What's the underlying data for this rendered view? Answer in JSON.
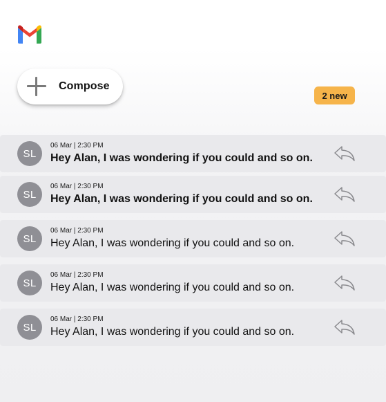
{
  "app": {
    "logo_icon": "gmail-logo-icon"
  },
  "compose": {
    "label": "Compose",
    "icon": "plus-icon"
  },
  "badge": {
    "label": "2 new",
    "color": "#f6b44a"
  },
  "emails": [
    {
      "avatar": "SL",
      "date": "06 Mar | 2:30 PM",
      "subject": "Hey Alan, I was wondering if you could and so on.",
      "unread": true,
      "action_icon": "reply-icon"
    },
    {
      "avatar": "SL",
      "date": "06 Mar | 2:30 PM",
      "subject": "Hey Alan, I was wondering if you could and so on.",
      "unread": true,
      "action_icon": "reply-icon"
    },
    {
      "avatar": "SL",
      "date": "06 Mar | 2:30 PM",
      "subject": "Hey Alan, I was wondering if you could and so on.",
      "unread": false,
      "action_icon": "reply-icon"
    },
    {
      "avatar": "SL",
      "date": "06 Mar | 2:30 PM",
      "subject": "Hey Alan, I was wondering if you could and so on.",
      "unread": false,
      "action_icon": "reply-icon"
    },
    {
      "avatar": "SL",
      "date": "06 Mar | 2:30 PM",
      "subject": "Hey Alan, I was wondering if you could and so on.",
      "unread": false,
      "action_icon": "reply-icon"
    }
  ],
  "colors": {
    "row_background": "#e9e9ec",
    "avatar_background": "#8f8f95",
    "gmail_red": "#ea4335",
    "gmail_blue": "#4285f4",
    "gmail_green": "#34a853",
    "gmail_yellow": "#fbbc04",
    "gmail_dark_red": "#c5221f"
  }
}
